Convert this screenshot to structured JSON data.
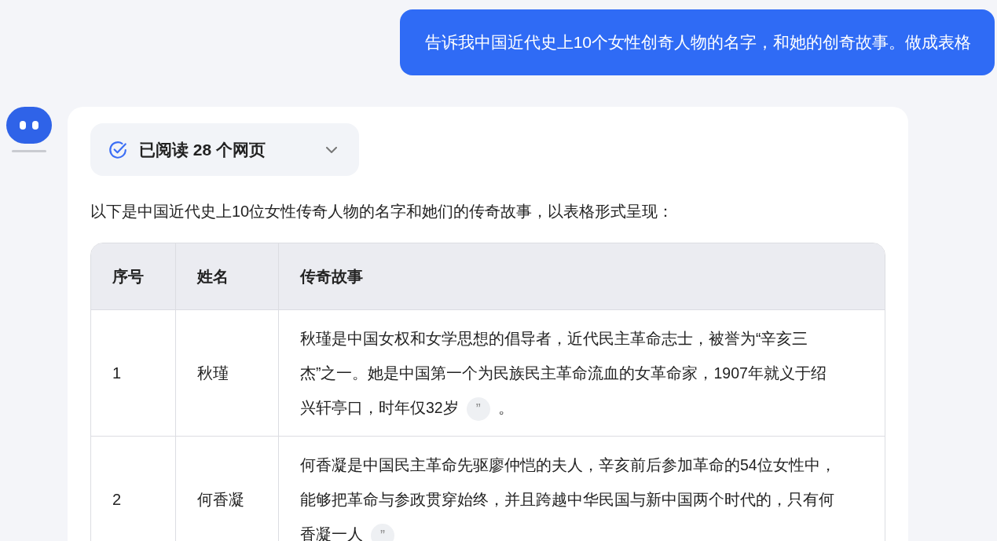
{
  "user_message": "告诉我中国近代史上10个女性创奇人物的名字，和她的创奇故事。做成表格",
  "answer": {
    "sources": {
      "label": "已阅读 28 个网页",
      "expanded": false
    },
    "intro": "以下是中国近代史上10位女性传奇人物的名字和她们的传奇故事，以表格形式呈现：",
    "table": {
      "columns": [
        "序号",
        "姓名",
        "传奇故事"
      ],
      "rows": [
        {
          "number": "1",
          "name": "秋瑾",
          "story": "秋瑾是中国女权和女学思想的倡导者，近代民主革命志士，被誉为“辛亥三杰”之一。她是中国第一个为民族民主革命流血的女革命家，1907年就义于绍兴轩亭口，时年仅32岁",
          "citation": "”",
          "after": "。"
        },
        {
          "number": "2",
          "name": "何香凝",
          "story": "何香凝是中国民主革命先驱廖仲恺的夫人，辛亥前后参加革命的54位女性中，能够把革命与参政贯穿始终，并且跨越中华民国与新中国两个时代的，只有何香凝一人",
          "citation": "”"
        }
      ]
    }
  }
}
